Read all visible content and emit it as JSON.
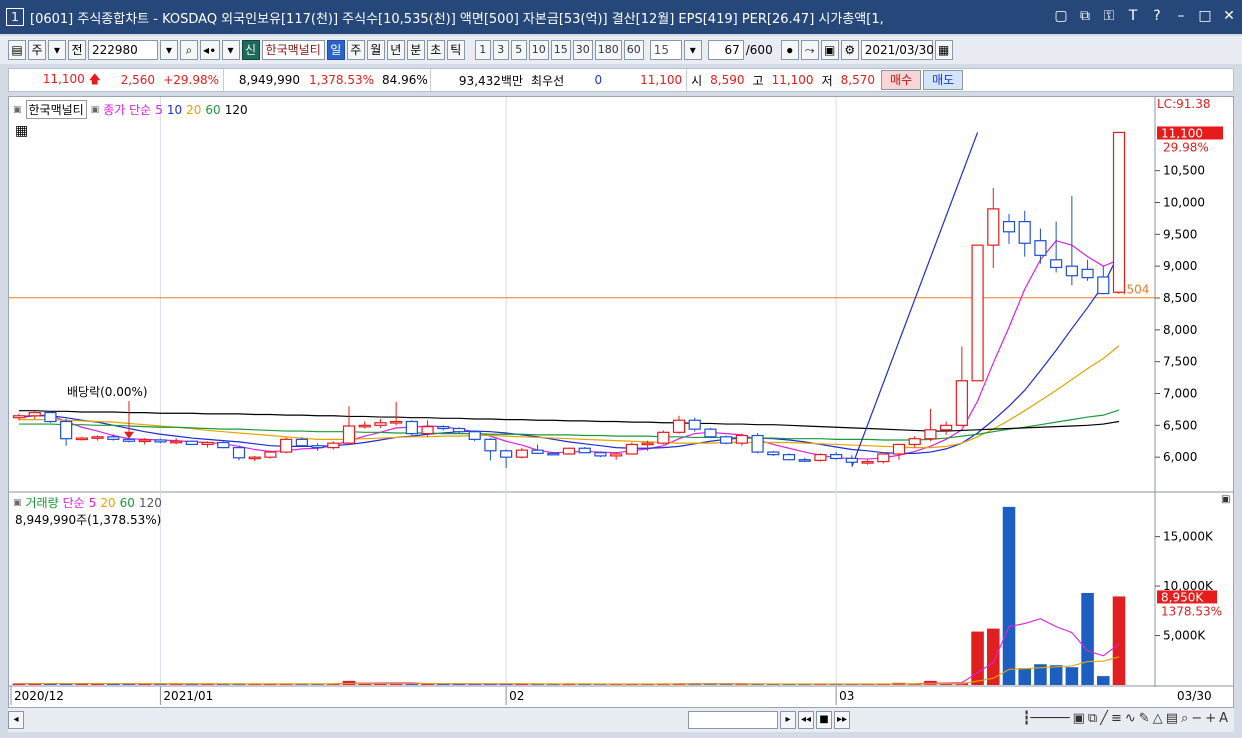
{
  "window": {
    "title": "[0601] 주식종합차트 - KOSDAQ 외국인보유[117(천)] 주식수[10,535(천)] 액면[500] 자본금[53(억)] 결산[12월] EPS[419] PER[26.47] 시가총액[1,"
  },
  "toolbar": {
    "period_unit": "주",
    "mode": "전",
    "code": "222980",
    "new_badge": "신",
    "stock_name": "한국맥널티",
    "periods": [
      "일",
      "주",
      "월",
      "년",
      "분",
      "초",
      "틱"
    ],
    "active_period": "일",
    "numbers": [
      "1",
      "3",
      "5",
      "10",
      "15",
      "30",
      "180",
      "60"
    ],
    "interval": "15",
    "count": "67",
    "count_max": "/600",
    "date": "2021/03/30"
  },
  "price": {
    "current": "11,100",
    "change": "2,560",
    "change_pct": "+29.98%",
    "volume": "8,949,990",
    "volume_pct": "1,378.53%",
    "turnover": "84.96%",
    "amount": "93,432백만",
    "best_bid_label": "최우선",
    "best_bid_qty": "0",
    "best_price": "11,100",
    "open_label": "시",
    "open": "8,590",
    "high_label": "고",
    "high": "11,100",
    "low_label": "저",
    "low": "8,570",
    "buy": "매수",
    "sell": "매도"
  },
  "price_panel": {
    "stock_label": "한국맥널티",
    "ma_label": "종가 단순",
    "ma_periods": [
      "5",
      "10",
      "20",
      "60",
      "120"
    ],
    "ma_colors": [
      "#e020e0",
      "#1c2cd8",
      "#e5a500",
      "#1a9a3a",
      "#000000"
    ],
    "lc_label": "LC:91.38",
    "last_price_label": "11,100",
    "last_pct_label": "29.98%",
    "hline_value": 8504,
    "hline_label": "8,504",
    "dividend_label": "배당락(0.00%)"
  },
  "volume_panel": {
    "title": "거래량",
    "ma_label": "단순",
    "ma_periods": [
      "5",
      "20",
      "60",
      "120"
    ],
    "volume_text": "8,949,990주(1,378.53%)",
    "last_label": "8,950K",
    "last_pct": "1378.53%"
  },
  "x_axis": {
    "labels": [
      "2020/12",
      "2021/01",
      "02",
      "03"
    ],
    "right_date": "03/30"
  },
  "chart_data": [
    {
      "type": "candlestick",
      "title": "한국맥널티",
      "ylim": [
        5500,
        11500
      ],
      "y_ticks": [
        6000,
        6500,
        7000,
        7500,
        8000,
        8500,
        9000,
        9500,
        10000,
        10500
      ],
      "candles": [
        [
          6620,
          6680,
          6580,
          6650
        ],
        [
          6650,
          6720,
          6600,
          6700
        ],
        [
          6700,
          6720,
          6540,
          6560
        ],
        [
          6560,
          6600,
          6180,
          6290
        ],
        [
          6290,
          6320,
          6260,
          6300
        ],
        [
          6300,
          6340,
          6260,
          6320
        ],
        [
          6320,
          6360,
          6260,
          6280
        ],
        [
          6280,
          6300,
          6230,
          6250
        ],
        [
          6250,
          6300,
          6200,
          6270
        ],
        [
          6270,
          6290,
          6220,
          6240
        ],
        [
          6240,
          6300,
          6200,
          6250
        ],
        [
          6250,
          6260,
          6190,
          6200
        ],
        [
          6200,
          6250,
          6150,
          6230
        ],
        [
          6230,
          6250,
          6140,
          6150
        ],
        [
          6150,
          6180,
          5950,
          5990
        ],
        [
          5990,
          6020,
          5940,
          6000
        ],
        [
          6000,
          6100,
          5980,
          6080
        ],
        [
          6080,
          6310,
          6060,
          6280
        ],
        [
          6280,
          6310,
          6170,
          6180
        ],
        [
          6180,
          6220,
          6100,
          6150
        ],
        [
          6150,
          6250,
          6120,
          6220
        ],
        [
          6220,
          6800,
          6190,
          6490
        ],
        [
          6490,
          6560,
          6450,
          6500
        ],
        [
          6500,
          6600,
          6460,
          6540
        ],
        [
          6540,
          6870,
          6500,
          6560
        ],
        [
          6560,
          6580,
          6340,
          6370
        ],
        [
          6370,
          6580,
          6320,
          6480
        ],
        [
          6480,
          6500,
          6420,
          6450
        ],
        [
          6450,
          6470,
          6380,
          6400
        ],
        [
          6400,
          6420,
          6250,
          6280
        ],
        [
          6280,
          6300,
          5950,
          6100
        ],
        [
          6100,
          6120,
          5830,
          6000
        ],
        [
          6000,
          6150,
          5980,
          6110
        ],
        [
          6110,
          6200,
          6050,
          6060
        ],
        [
          6060,
          6080,
          6030,
          6050
        ],
        [
          6050,
          6150,
          6040,
          6140
        ],
        [
          6140,
          6160,
          6060,
          6070
        ],
        [
          6070,
          6090,
          6000,
          6020
        ],
        [
          6020,
          6080,
          5960,
          6050
        ],
        [
          6050,
          6230,
          6040,
          6200
        ],
        [
          6200,
          6260,
          6100,
          6220
        ],
        [
          6220,
          6420,
          6200,
          6390
        ],
        [
          6390,
          6650,
          6370,
          6580
        ],
        [
          6580,
          6620,
          6400,
          6440
        ],
        [
          6440,
          6460,
          6300,
          6320
        ],
        [
          6320,
          6340,
          6200,
          6220
        ],
        [
          6220,
          6370,
          6180,
          6340
        ],
        [
          6340,
          6380,
          6060,
          6080
        ],
        [
          6080,
          6100,
          6020,
          6040
        ],
        [
          6040,
          6060,
          5950,
          5960
        ],
        [
          5960,
          5990,
          5930,
          5950
        ],
        [
          5950,
          6060,
          5930,
          6040
        ],
        [
          6040,
          6080,
          5960,
          5980
        ],
        [
          5980,
          6030,
          5880,
          5920
        ],
        [
          5920,
          5960,
          5880,
          5930
        ],
        [
          5930,
          6050,
          5900,
          6050
        ],
        [
          6050,
          6090,
          5960,
          6200
        ],
        [
          6200,
          6330,
          6150,
          6290
        ],
        [
          6290,
          6760,
          6250,
          6430
        ],
        [
          6430,
          6560,
          6350,
          6500
        ],
        [
          6500,
          7740,
          6480,
          7200
        ],
        [
          7200,
          9330,
          8360,
          9330
        ],
        [
          9330,
          10230,
          8970,
          9900
        ],
        [
          9700,
          9820,
          9350,
          9540
        ],
        [
          9700,
          9870,
          9150,
          9360
        ],
        [
          9400,
          9590,
          9040,
          9170
        ],
        [
          9100,
          9700,
          8900,
          8980
        ],
        [
          9000,
          10100,
          8700,
          8850
        ],
        [
          8950,
          9100,
          8770,
          8820
        ],
        [
          8830,
          9000,
          8560,
          8570
        ],
        [
          8590,
          11100,
          8570,
          11100
        ]
      ],
      "ma5": [
        6620,
        6650,
        6660,
        6560,
        6470,
        6410,
        6340,
        6290,
        6280,
        6270,
        6260,
        6240,
        6230,
        6210,
        6170,
        6120,
        6090,
        6100,
        6130,
        6140,
        6180,
        6260,
        6330,
        6390,
        6460,
        6470,
        6490,
        6480,
        6440,
        6400,
        6330,
        6250,
        6190,
        6110,
        6070,
        6080,
        6090,
        6080,
        6070,
        6100,
        6130,
        6180,
        6290,
        6370,
        6390,
        6370,
        6350,
        6270,
        6200,
        6140,
        6080,
        6030,
        5990,
        5980,
        5970,
        5990,
        6030,
        6090,
        6170,
        6280,
        6430,
        6880,
        7480,
        8040,
        8640,
        9100,
        9400,
        9330,
        9150,
        9000,
        9100
      ],
      "ma10": [
        6640,
        6650,
        6650,
        6620,
        6580,
        6550,
        6500,
        6450,
        6400,
        6360,
        6330,
        6300,
        6280,
        6260,
        6240,
        6210,
        6180,
        6170,
        6170,
        6170,
        6180,
        6200,
        6230,
        6270,
        6310,
        6330,
        6360,
        6380,
        6400,
        6410,
        6400,
        6380,
        6350,
        6320,
        6280,
        6240,
        6210,
        6180,
        6150,
        6140,
        6140,
        6150,
        6170,
        6210,
        6250,
        6280,
        6300,
        6300,
        6290,
        6270,
        6240,
        6200,
        6160,
        6120,
        6100,
        6070,
        6060,
        6060,
        6080,
        6130,
        6220,
        6380,
        6580,
        6800,
        7050,
        7360,
        7680,
        8020,
        8350,
        8700,
        9200
      ],
      "ma20": [
        6590,
        6590,
        6590,
        6580,
        6570,
        6560,
        6550,
        6530,
        6510,
        6490,
        6470,
        6450,
        6420,
        6400,
        6380,
        6360,
        6340,
        6320,
        6300,
        6280,
        6280,
        6280,
        6290,
        6300,
        6310,
        6320,
        6320,
        6330,
        6330,
        6340,
        6340,
        6330,
        6320,
        6310,
        6300,
        6290,
        6280,
        6270,
        6260,
        6250,
        6240,
        6230,
        6220,
        6220,
        6220,
        6230,
        6230,
        6230,
        6230,
        6230,
        6220,
        6210,
        6200,
        6190,
        6180,
        6170,
        6160,
        6150,
        6150,
        6170,
        6220,
        6320,
        6440,
        6580,
        6730,
        6890,
        7050,
        7220,
        7390,
        7550,
        7750
      ],
      "ma60": [
        6520,
        6520,
        6520,
        6510,
        6510,
        6500,
        6500,
        6490,
        6480,
        6470,
        6470,
        6460,
        6450,
        6440,
        6440,
        6430,
        6420,
        6410,
        6410,
        6400,
        6400,
        6400,
        6390,
        6390,
        6380,
        6380,
        6380,
        6370,
        6370,
        6370,
        6360,
        6360,
        6360,
        6350,
        6350,
        6350,
        6340,
        6340,
        6330,
        6330,
        6330,
        6320,
        6320,
        6310,
        6310,
        6310,
        6300,
        6300,
        6300,
        6290,
        6290,
        6290,
        6280,
        6280,
        6280,
        6270,
        6270,
        6270,
        6280,
        6300,
        6330,
        6360,
        6400,
        6440,
        6470,
        6510,
        6550,
        6590,
        6630,
        6660,
        6740
      ],
      "ma120": [
        6730,
        6730,
        6720,
        6720,
        6710,
        6710,
        6710,
        6700,
        6700,
        6690,
        6690,
        6690,
        6680,
        6680,
        6680,
        6670,
        6670,
        6660,
        6660,
        6650,
        6650,
        6640,
        6640,
        6630,
        6630,
        6620,
        6620,
        6610,
        6610,
        6600,
        6600,
        6590,
        6590,
        6580,
        6580,
        6570,
        6570,
        6560,
        6560,
        6550,
        6550,
        6540,
        6540,
        6530,
        6530,
        6520,
        6520,
        6510,
        6510,
        6500,
        6490,
        6480,
        6470,
        6460,
        6450,
        6440,
        6430,
        6420,
        6410,
        6410,
        6420,
        6430,
        6440,
        6450,
        6460,
        6470,
        6480,
        6490,
        6500,
        6520,
        6560
      ]
    },
    {
      "type": "bar",
      "title": "거래량",
      "ylim": [
        0,
        19000
      ],
      "y_ticks": [
        5000,
        10000,
        15000
      ],
      "y_tick_labels": [
        "5,000K",
        "10,000K",
        "15,000K"
      ],
      "values": [
        150,
        160,
        140,
        170,
        130,
        120,
        130,
        110,
        120,
        100,
        110,
        100,
        90,
        100,
        110,
        100,
        90,
        120,
        100,
        110,
        110,
        420,
        160,
        140,
        170,
        130,
        120,
        100,
        110,
        100,
        120,
        110,
        100,
        90,
        90,
        100,
        90,
        90,
        80,
        110,
        110,
        130,
        160,
        130,
        110,
        100,
        110,
        100,
        90,
        80,
        80,
        90,
        90,
        80,
        80,
        130,
        220,
        120,
        420,
        130,
        240,
        5400,
        5700,
        18000,
        1700,
        2100,
        2000,
        1800,
        9300,
        900,
        8950
      ],
      "ma5": [
        150,
        150,
        150,
        150,
        150,
        140,
        140,
        130,
        120,
        120,
        110,
        110,
        110,
        110,
        110,
        100,
        100,
        100,
        100,
        100,
        110,
        180,
        190,
        200,
        210,
        210,
        140,
        130,
        120,
        110,
        110,
        110,
        110,
        100,
        100,
        100,
        100,
        90,
        90,
        90,
        90,
        100,
        110,
        130,
        130,
        130,
        120,
        110,
        100,
        100,
        90,
        90,
        90,
        80,
        80,
        90,
        110,
        120,
        190,
        200,
        230,
        1260,
        2280,
        5910,
        6210,
        6700,
        5900,
        5300,
        3450,
        2950,
        4150
      ],
      "ma20": [
        140,
        140,
        140,
        140,
        140,
        140,
        140,
        140,
        140,
        130,
        130,
        130,
        130,
        120,
        120,
        120,
        120,
        120,
        120,
        120,
        120,
        140,
        140,
        140,
        140,
        140,
        140,
        140,
        140,
        140,
        140,
        140,
        140,
        120,
        120,
        120,
        120,
        110,
        110,
        110,
        110,
        110,
        110,
        110,
        110,
        110,
        110,
        110,
        110,
        110,
        110,
        110,
        110,
        110,
        110,
        110,
        110,
        110,
        120,
        130,
        130,
        400,
        680,
        1580,
        1650,
        1750,
        1840,
        1920,
        2370,
        2410,
        2850
      ]
    }
  ]
}
